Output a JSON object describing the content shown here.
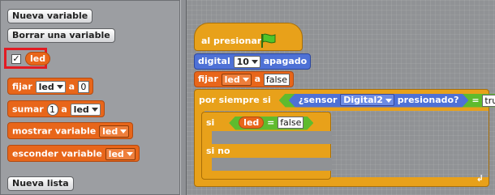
{
  "palette": {
    "new_variable_label": "Nueva variable",
    "delete_variable_label": "Borrar una variable",
    "variable_name": "led",
    "variable_checked": true,
    "blocks": {
      "set": {
        "label": "fijar",
        "var": "led",
        "to": "a",
        "value": "0"
      },
      "change": {
        "label": "sumar",
        "value": "1",
        "to": "a",
        "var": "led"
      },
      "show": {
        "label": "mostrar variable",
        "var": "led"
      },
      "hide": {
        "label": "esconder variable",
        "var": "led"
      }
    },
    "new_list_label": "Nueva lista"
  },
  "script": {
    "hat_label": "al presionar",
    "digital": {
      "label": "digital",
      "pin": "10",
      "state": "apagado"
    },
    "set": {
      "label": "fijar",
      "var": "led",
      "to": "a",
      "value": "false"
    },
    "forever": {
      "label": "por siempre si",
      "sensor_label": "¿sensor",
      "sensor_pin": "Digital2",
      "pressed_label": "presionado?",
      "eq": "=",
      "value": "true"
    },
    "ifelse": {
      "if_label": "si",
      "var": "led",
      "eq": "=",
      "value": "false",
      "else_label": "si no"
    },
    "loop_symbol": "↲"
  },
  "colors": {
    "variables": "#e8661a",
    "control": "#e8a11a",
    "motor": "#4e71d6",
    "operators": "#5fbb2e",
    "highlight": "#e21b23"
  },
  "icons": {
    "flag": "green-flag-icon",
    "check": "checkmark-icon"
  }
}
